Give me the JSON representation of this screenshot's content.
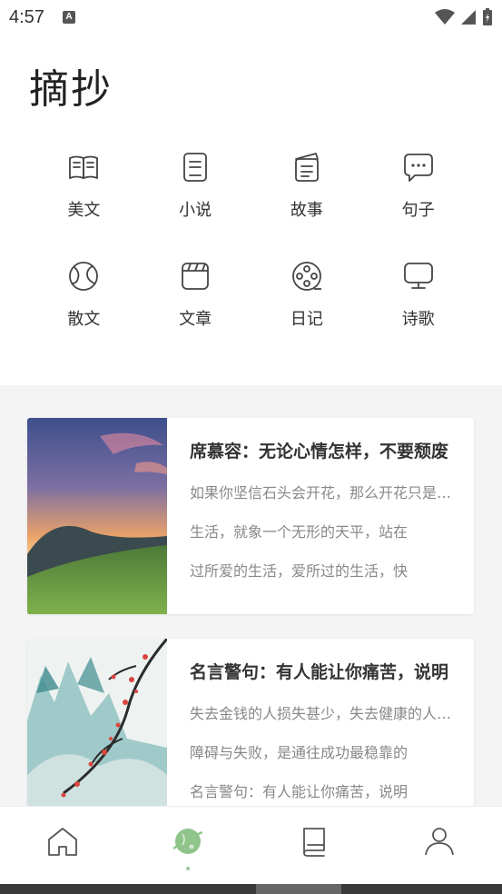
{
  "status": {
    "time": "4:57",
    "notif_icon": "A"
  },
  "page": {
    "title": "摘抄"
  },
  "categories": [
    {
      "label": "美文",
      "icon": "book-open-icon"
    },
    {
      "label": "小说",
      "icon": "document-icon"
    },
    {
      "label": "故事",
      "icon": "folder-doc-icon"
    },
    {
      "label": "句子",
      "icon": "chat-bubble-icon"
    },
    {
      "label": "散文",
      "icon": "globe-leaf-icon"
    },
    {
      "label": "文章",
      "icon": "clapperboard-icon"
    },
    {
      "label": "日记",
      "icon": "film-reel-icon"
    },
    {
      "label": "诗歌",
      "icon": "monitor-icon"
    }
  ],
  "articles": [
    {
      "title": "席慕容：无论心情怎样，不要颓废",
      "lines": [
        "如果你坚信石头会开花，那么开花只是时间问题",
        "生活，就象一个无形的天平，站在",
        "过所爱的生活，爱所过的生活，快"
      ],
      "image": "sunset-mountain-image"
    },
    {
      "title": "名言警句：有人能让你痛苦，说明",
      "lines": [
        "失去金钱的人损失甚少，失去健康的人损失极多",
        "障碍与失败，是通往成功最稳靠的",
        "名言警句：有人能让你痛苦，说明"
      ],
      "image": "plum-blossom-painting-image"
    }
  ],
  "nav": [
    {
      "label": "home",
      "icon": "home-icon"
    },
    {
      "label": "discover",
      "icon": "planet-icon",
      "active": true
    },
    {
      "label": "library",
      "icon": "book-stack-icon"
    },
    {
      "label": "profile",
      "icon": "person-icon"
    }
  ],
  "colors": {
    "accent": "#8fc48a",
    "text": "#333333",
    "muted": "#888888"
  }
}
